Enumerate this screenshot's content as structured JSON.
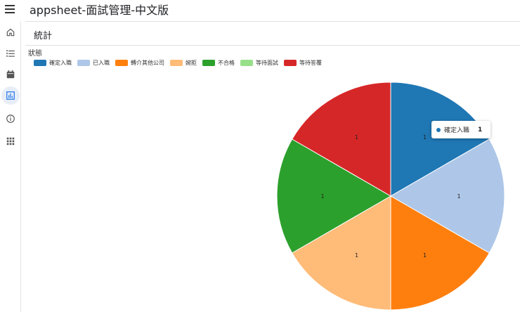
{
  "app": {
    "title": "appsheet-面試管理-中文版"
  },
  "sidebar": {
    "items": [
      {
        "name": "home",
        "icon": "home-icon"
      },
      {
        "name": "list",
        "icon": "list-icon"
      },
      {
        "name": "calendar",
        "icon": "calendar-icon"
      },
      {
        "name": "chart",
        "icon": "bar-chart-icon",
        "active": true
      },
      {
        "name": "info",
        "icon": "info-icon"
      },
      {
        "name": "apps",
        "icon": "apps-grid-icon"
      }
    ]
  },
  "page": {
    "title": "統計"
  },
  "chart_data": {
    "type": "pie",
    "legend_title": "狀態",
    "legend_position": "top-left",
    "categories": [
      "確定入職",
      "已入職",
      "轉介其他公司",
      "婉拒",
      "不合格",
      "等待面試",
      "等待答覆"
    ],
    "colors": [
      "#1f77b4",
      "#aec7e8",
      "#ff7f0e",
      "#ffbb78",
      "#2ca02c",
      "#98df8a",
      "#d62728"
    ],
    "values": [
      1,
      1,
      1,
      1,
      1,
      0,
      1
    ],
    "slice_labels": [
      "1",
      "1",
      "1",
      "1",
      "1",
      "",
      "1"
    ]
  },
  "tooltip": {
    "label": "確定入職",
    "value": "1",
    "color": "#1f77b4"
  }
}
